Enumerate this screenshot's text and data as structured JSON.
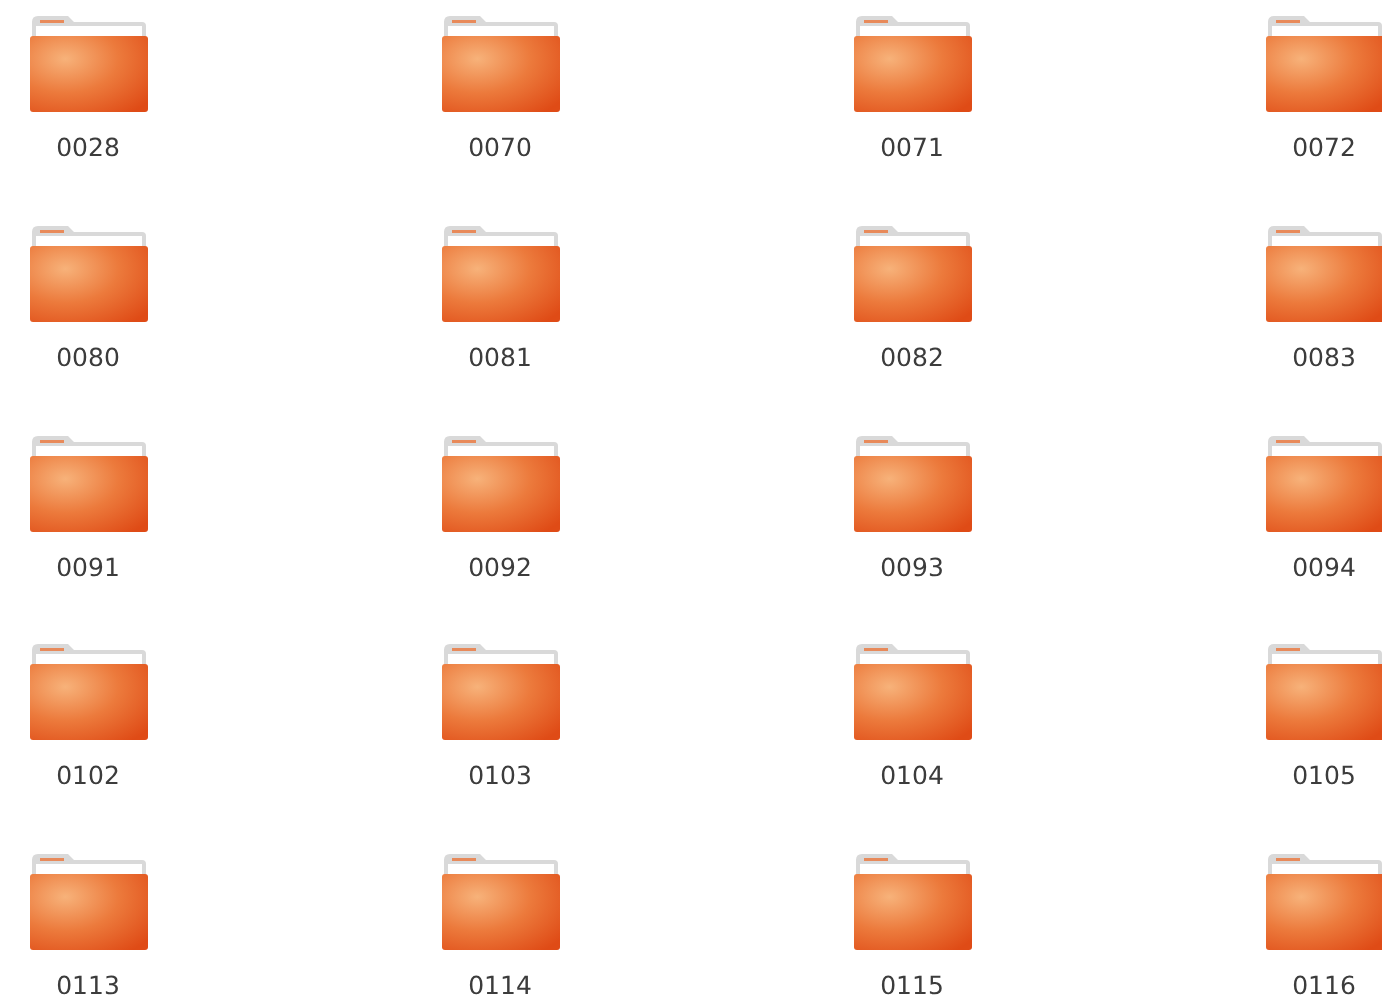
{
  "folders": [
    {
      "name": "0028"
    },
    {
      "name": "0070"
    },
    {
      "name": "0071"
    },
    {
      "name": "0072"
    },
    {
      "name": "0080"
    },
    {
      "name": "0081"
    },
    {
      "name": "0082"
    },
    {
      "name": "0083"
    },
    {
      "name": "0091"
    },
    {
      "name": "0092"
    },
    {
      "name": "0093"
    },
    {
      "name": "0094"
    },
    {
      "name": "0102"
    },
    {
      "name": "0103"
    },
    {
      "name": "0104"
    },
    {
      "name": "0105"
    },
    {
      "name": "0113"
    },
    {
      "name": "0114"
    },
    {
      "name": "0115"
    },
    {
      "name": "0116"
    }
  ]
}
